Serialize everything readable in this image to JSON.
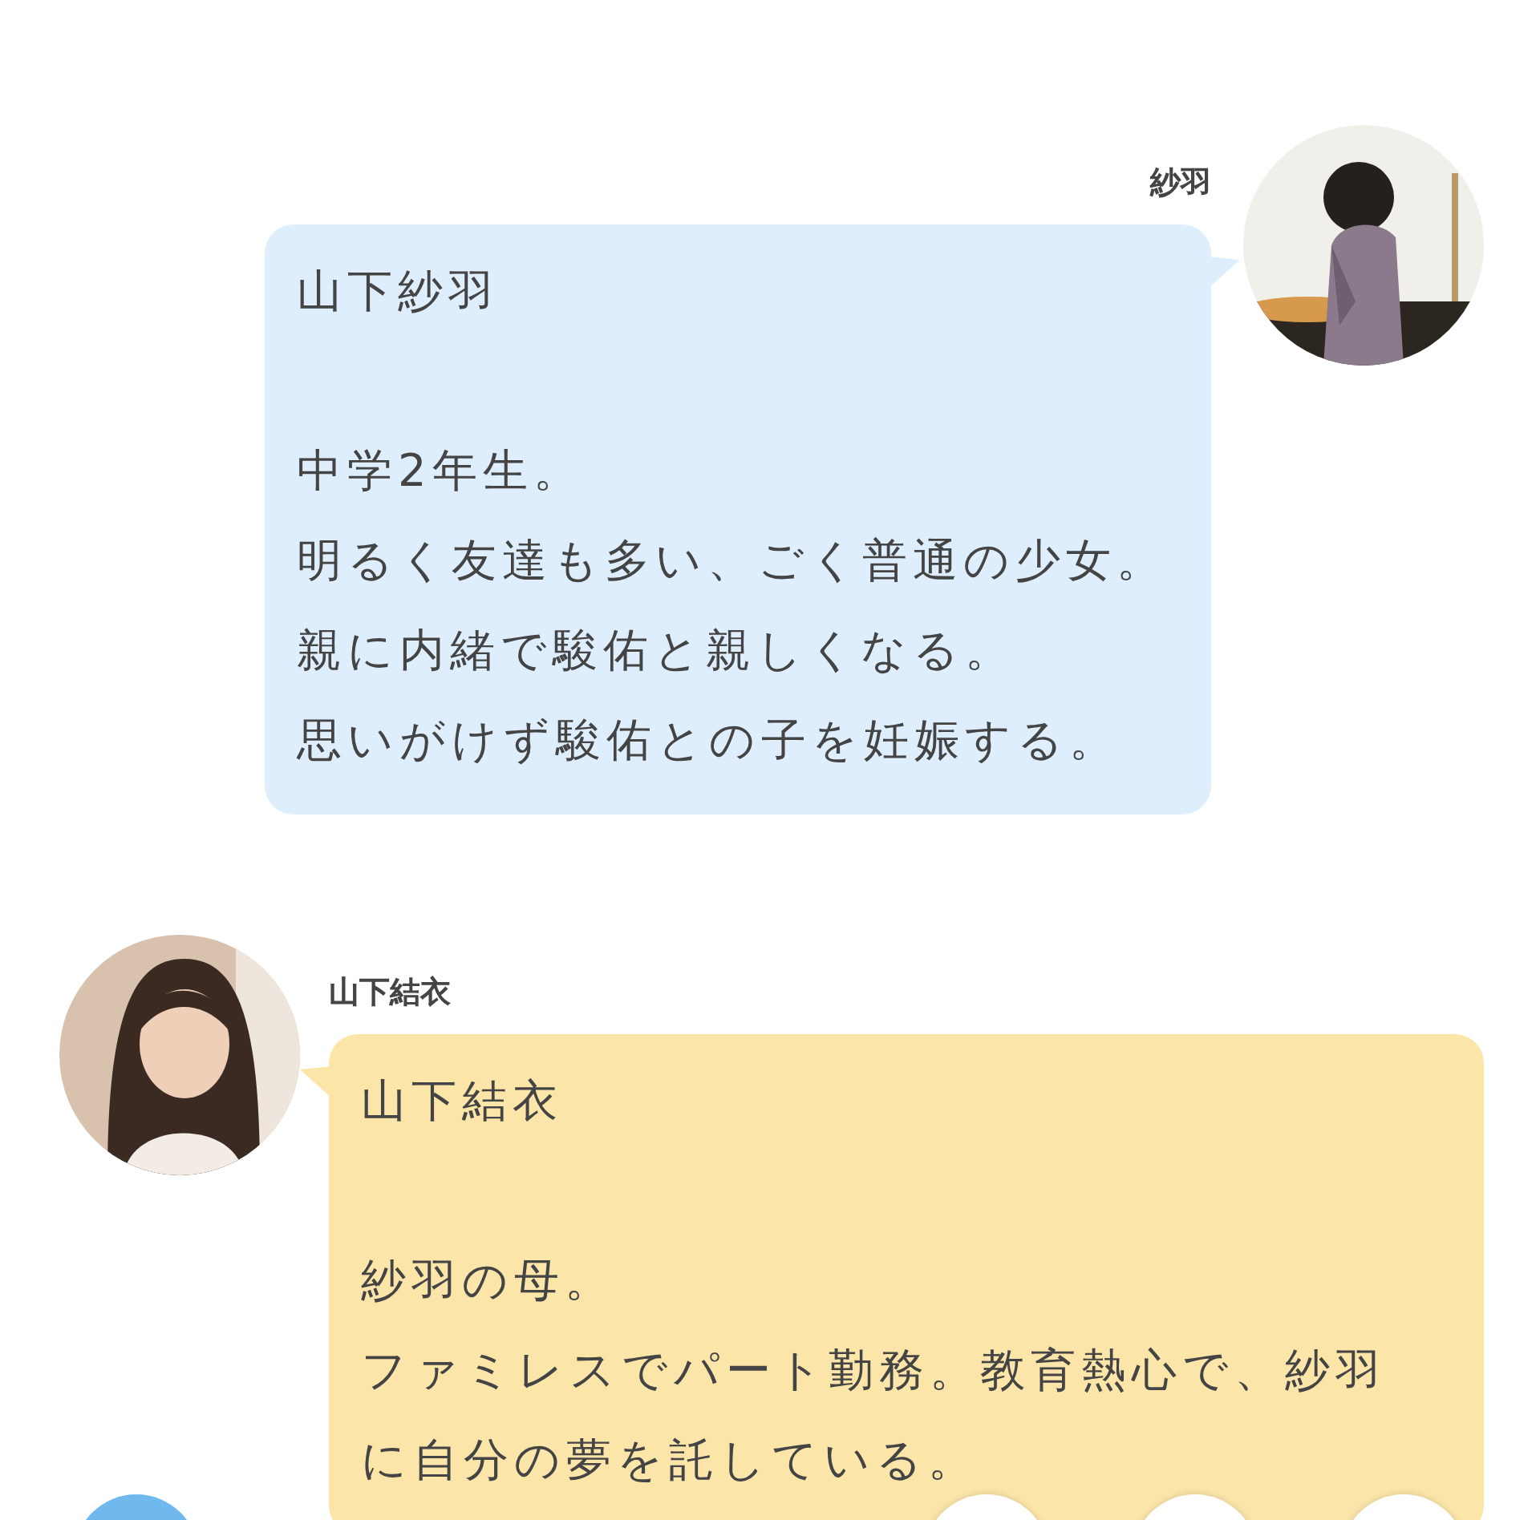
{
  "messages": [
    {
      "kind": "outgoing",
      "name": "紗羽",
      "title": "山下紗羽",
      "lines": [
        "中学2年生。",
        "明るく友達も多い、ごく普通の少女。",
        "親に内緒で駿佑と親しくなる。",
        "思いがけず駿佑との子を妊娠する。"
      ],
      "color": "#dfeefd",
      "avatar": {
        "kind": "picture"
      }
    },
    {
      "kind": "incoming",
      "name": "山下結衣",
      "title": "山下結衣",
      "lines": [
        "紗羽の母。",
        "ファミレスでパート勤務。教育熱心で、紗羽",
        "に自分の夢を託している。"
      ],
      "color": "#fbe5a9",
      "avatar": {
        "kind": "picture"
      }
    }
  ]
}
